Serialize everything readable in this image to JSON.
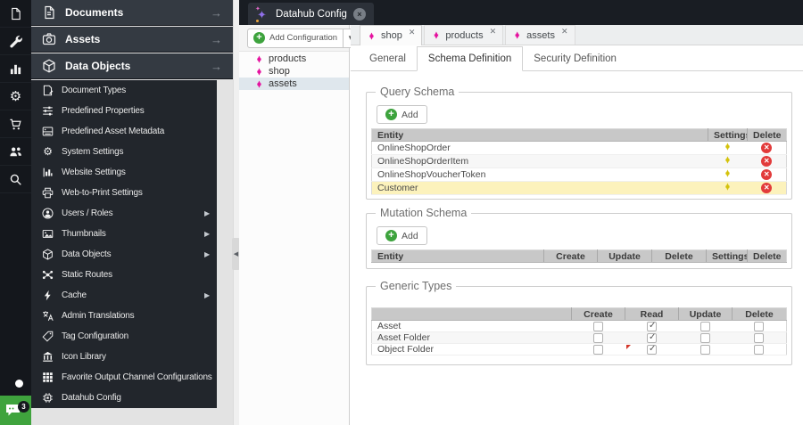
{
  "window_tab": {
    "title": "Datahub Config",
    "close_label": "×"
  },
  "rail_icons": [
    "documents",
    "tools",
    "reports",
    "settings",
    "ecommerce",
    "users",
    "search"
  ],
  "sidebar": {
    "accordions": [
      {
        "label": "Documents",
        "icon": "documents-icon"
      },
      {
        "label": "Assets",
        "icon": "assets-camera-icon"
      },
      {
        "label": "Data Objects",
        "icon": "data-objects-cube-icon"
      }
    ],
    "items": [
      {
        "label": "Document Types",
        "icon": "document-types-icon"
      },
      {
        "label": "Predefined Properties",
        "icon": "predefined-properties-icon"
      },
      {
        "label": "Predefined Asset Metadata",
        "icon": "predefined-asset-metadata-icon"
      },
      {
        "label": "System Settings",
        "icon": "system-settings-gear-icon"
      },
      {
        "label": "Website Settings",
        "icon": "website-settings-chart-icon"
      },
      {
        "label": "Web-to-Print Settings",
        "icon": "printer-icon"
      },
      {
        "label": "Users / Roles",
        "icon": "user-icon",
        "has_submenu": true
      },
      {
        "label": "Thumbnails",
        "icon": "image-icon",
        "has_submenu": true
      },
      {
        "label": "Data Objects",
        "icon": "cube-icon",
        "has_submenu": true
      },
      {
        "label": "Static Routes",
        "icon": "network-icon"
      },
      {
        "label": "Cache",
        "icon": "lightning-icon",
        "has_submenu": true
      },
      {
        "label": "Admin Translations",
        "icon": "translate-icon"
      },
      {
        "label": "Tag Configuration",
        "icon": "tag-icon"
      },
      {
        "label": "Icon Library",
        "icon": "bank-icon"
      },
      {
        "label": "Favorite Output Channel Configurations",
        "icon": "grid-icon"
      },
      {
        "label": "Datahub Config",
        "icon": "chip-icon"
      }
    ],
    "notification_badge": "3"
  },
  "config_panel": {
    "add_button_label": "Add Configuration",
    "tree_items": [
      {
        "label": "products"
      },
      {
        "label": "shop"
      },
      {
        "label": "assets"
      }
    ],
    "selected_item": "assets"
  },
  "editor": {
    "doc_tabs": [
      {
        "label": "shop"
      },
      {
        "label": "products"
      },
      {
        "label": "assets"
      }
    ],
    "active_doc_tab": "shop",
    "sub_tabs": [
      {
        "label": "General"
      },
      {
        "label": "Schema Definition"
      },
      {
        "label": "Security Definition"
      }
    ],
    "active_sub_tab": "Schema Definition",
    "query_schema": {
      "legend": "Query Schema",
      "add_label": "Add",
      "columns": [
        "Entity",
        "Settings",
        "Delete"
      ],
      "rows": [
        {
          "entity": "OnlineShopOrder"
        },
        {
          "entity": "OnlineShopOrderItem"
        },
        {
          "entity": "OnlineShopVoucherToken"
        },
        {
          "entity": "Customer"
        }
      ],
      "selected_row": "Customer"
    },
    "mutation_schema": {
      "legend": "Mutation Schema",
      "add_label": "Add",
      "columns": [
        "Entity",
        "Create",
        "Update",
        "Delete",
        "Settings",
        "Delete"
      ],
      "rows": []
    },
    "generic_types": {
      "legend": "Generic Types",
      "columns": [
        "",
        "Create",
        "Read",
        "Update",
        "Delete"
      ],
      "rows": [
        {
          "name": "Asset",
          "create": false,
          "read": true,
          "update": false,
          "delete": false
        },
        {
          "name": "Asset Folder",
          "create": false,
          "read": true,
          "update": false,
          "delete": false
        },
        {
          "name": "Object Folder",
          "create": false,
          "read": true,
          "update": false,
          "delete": false,
          "read_modified": true
        }
      ]
    }
  },
  "colors": {
    "accent_green": "#3da33d",
    "brand_pink": "#e5109e",
    "settings_yellow": "#d4c20a",
    "delete_red": "#e23b3b",
    "selected_row_yellow": "#fcf2bc"
  }
}
